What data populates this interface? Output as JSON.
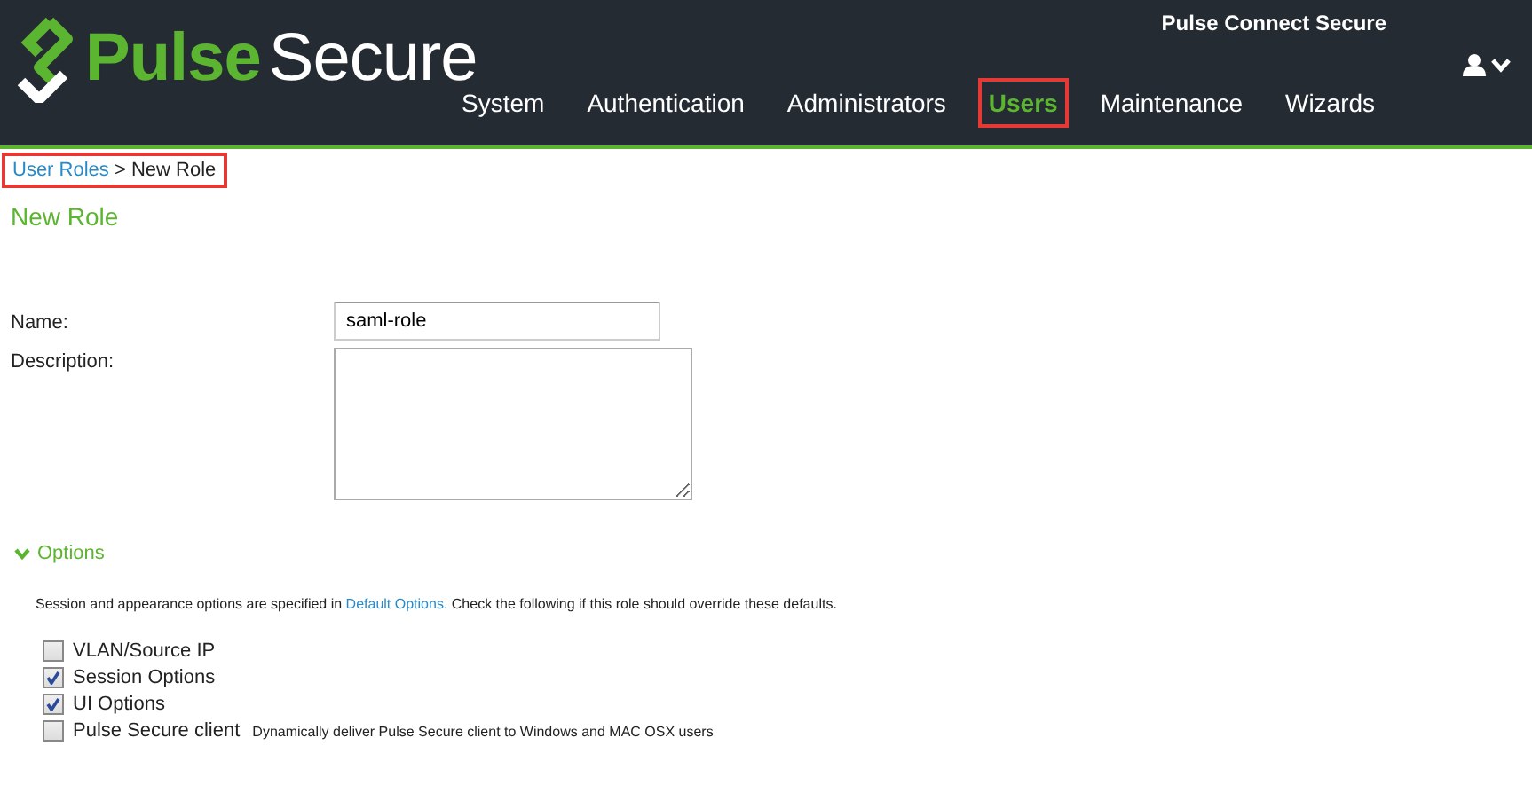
{
  "header": {
    "logo_text_1": "Pulse",
    "logo_text_2": "Secure",
    "product": "Pulse Connect Secure",
    "nav": [
      {
        "label": "System",
        "selected": false,
        "highlighted": false
      },
      {
        "label": "Authentication",
        "selected": false,
        "highlighted": false
      },
      {
        "label": "Administrators",
        "selected": false,
        "highlighted": false
      },
      {
        "label": "Users",
        "selected": true,
        "highlighted": true
      },
      {
        "label": "Maintenance",
        "selected": false,
        "highlighted": false
      },
      {
        "label": "Wizards",
        "selected": false,
        "highlighted": false
      }
    ]
  },
  "breadcrumb": {
    "link": "User Roles",
    "separator": ">",
    "current": "New Role",
    "highlighted": true
  },
  "page_title": "New Role",
  "form": {
    "name_label": "Name:",
    "name_value": "saml-role",
    "description_label": "Description:"
  },
  "options": {
    "title": "Options",
    "expanded": true,
    "note_before": "Session and appearance options are specified in",
    "note_link": "Default Options.",
    "note_after": "Check the following if this role should override these defaults.",
    "items": [
      {
        "label": "VLAN/Source IP",
        "checked": false
      },
      {
        "label": "Session Options",
        "checked": true
      },
      {
        "label": "UI Options",
        "checked": true
      },
      {
        "label": "Pulse Secure client",
        "checked": false,
        "hint": "Dynamically deliver Pulse Secure client to Windows and MAC OSX users"
      }
    ]
  }
}
